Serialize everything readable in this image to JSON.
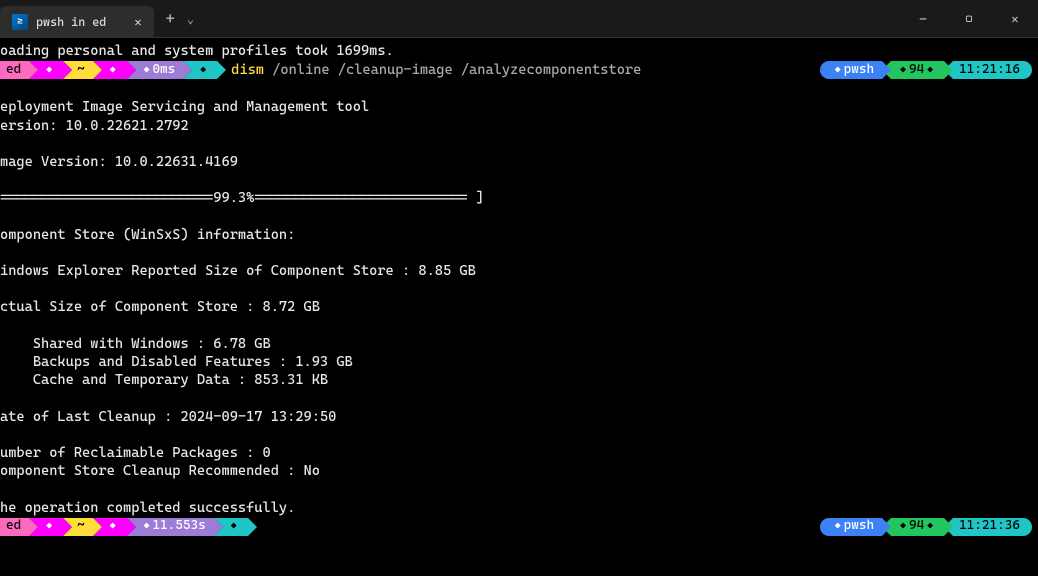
{
  "titlebar": {
    "tab_title": "pwsh in ed"
  },
  "output": {
    "loading": "oading personal and system profiles took 1699ms.",
    "tool_header": "eployment Image Servicing and Management tool",
    "version": "ersion: 10.0.22621.2792",
    "image_version": "mage Version: 10.0.22631.4169",
    "progress": "==========================99.3%========================== ]",
    "section_header": "omponent Store (WinSxS) information:",
    "reported_size": "indows Explorer Reported Size of Component Store : 8.85 GB",
    "actual_size": "ctual Size of Component Store : 8.72 GB",
    "shared": "    Shared with Windows : 6.78 GB",
    "backups": "    Backups and Disabled Features : 1.93 GB",
    "cache": "    Cache and Temporary Data : 853.31 KB",
    "last_cleanup": "ate of Last Cleanup : 2024-09-17 13:29:50",
    "reclaimable": "umber of Reclaimable Packages : 0",
    "recommended": "omponent Store Cleanup Recommended : No",
    "completed": "he operation completed successfully."
  },
  "prompt1": {
    "user": "ed",
    "home": "~",
    "duration": "0ms",
    "cmd_name": "dism",
    "cmd_args": "/online /cleanup-image /analyzecomponentstore",
    "shell": "pwsh",
    "mem": "94",
    "time": "11:21:16"
  },
  "prompt2": {
    "user": "ed",
    "home": "~",
    "duration": "11.553s",
    "shell": "pwsh",
    "mem": "94",
    "time": "11:21:36"
  }
}
